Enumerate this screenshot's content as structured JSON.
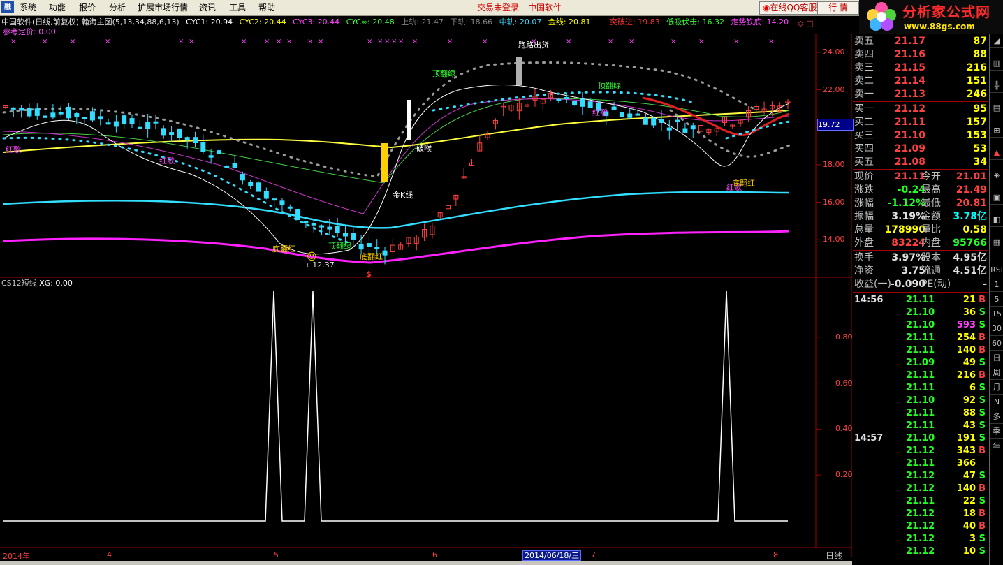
{
  "menu": {
    "items": [
      "系统",
      "功能",
      "报价",
      "分析",
      "扩展市场行情",
      "资讯",
      "工具",
      "帮助"
    ],
    "login_status": "交易未登录",
    "brand": "中国软件",
    "qq_button": "在线QQ客服",
    "market_button": "行 情",
    "logo_main": "分析家公式网",
    "logo_url": "www.88gs.com"
  },
  "chart_header": {
    "title": "中国软件(日线,前复权) 翰海主图(5,13,34,88,6,13)",
    "cyc1": "CYC1: 20.94",
    "cyc2": "CYC2: 20.44",
    "cyc3": "CYC3: 20.44",
    "cyc_inf": "CYC∞: 20.48",
    "upper": "上轨: 21.47",
    "lower": "下轨: 18.66",
    "mid": "中轨: 20.07",
    "gold": "金线: 20.81",
    "breakout": "突破进: 19.83",
    "lowbuy": "低吸伏击: 16.32",
    "trend": "走势铁底: 14.20",
    "ref_price": "参考定价: 0.00"
  },
  "sub_header": {
    "name": "CS12短线",
    "xg": "XG: 0.00"
  },
  "price_marker": "19.72",
  "annotations": {
    "red_song1": "红歌",
    "red_song2": "红歌",
    "red_song3": "红歌",
    "top_green1": "顶翻绿",
    "top_green2": "顶翻绿",
    "top_green3": "顶翻绿",
    "bottom_red1": "底翻红",
    "bottom_red2": "底翻红",
    "bottom_red3": "底翻红",
    "crack": "破喉",
    "gold_k": "金K线",
    "sell": "跑路出货",
    "low_price": "12.37",
    "red_swing": "红歌"
  },
  "chart_data": [
    {
      "type": "line",
      "panel": "main",
      "y_ticks": [
        "24.00",
        "22.00",
        "20.00",
        "18.00",
        "16.00",
        "14.00"
      ],
      "ylim": [
        12.0,
        25.0
      ],
      "x_labels": [
        "2014年",
        "4",
        "5",
        "6",
        "7",
        "8"
      ],
      "series": [
        {
          "name": "",
          "values": [
            21.1,
            20.9,
            20.8,
            20.7,
            20.5,
            20.3,
            20.1,
            19.8,
            19.2,
            18.5,
            17.5,
            16.5,
            15.6,
            14.9,
            14.4,
            13.8,
            13.5,
            13.8,
            14.5,
            16.5,
            19.0,
            20.8,
            21.3,
            21.5,
            21.3,
            21.0,
            20.8,
            20.5,
            20.2,
            20.0,
            20.1,
            20.5,
            21.0,
            21.2
          ]
        }
      ]
    },
    {
      "type": "line",
      "panel": "indicator",
      "y_ticks": [
        "0.80",
        "0.60",
        "0.40",
        "0.20"
      ],
      "ylim": [
        0,
        1.0
      ],
      "series": [
        {
          "name": "",
          "values": [
            0,
            0,
            0,
            0,
            0,
            0,
            0,
            0,
            0,
            0,
            0,
            0,
            0,
            1,
            0,
            1,
            0,
            0,
            0,
            0,
            0,
            0,
            0,
            0,
            0,
            0,
            0,
            0,
            0,
            0,
            0,
            0,
            0,
            0,
            0,
            0,
            0,
            0,
            0,
            1,
            0,
            0,
            0
          ]
        }
      ]
    }
  ],
  "quote": {
    "sells": [
      {
        "label": "卖五",
        "price": "21.17",
        "vol": "87"
      },
      {
        "label": "卖四",
        "price": "21.16",
        "vol": "88"
      },
      {
        "label": "卖三",
        "price": "21.15",
        "vol": "216"
      },
      {
        "label": "卖二",
        "price": "21.14",
        "vol": "151"
      },
      {
        "label": "卖一",
        "price": "21.13",
        "vol": "246"
      }
    ],
    "buys": [
      {
        "label": "买一",
        "price": "21.12",
        "vol": "95"
      },
      {
        "label": "买二",
        "price": "21.11",
        "vol": "157"
      },
      {
        "label": "买三",
        "price": "21.10",
        "vol": "153"
      },
      {
        "label": "买四",
        "price": "21.09",
        "vol": "53"
      },
      {
        "label": "买五",
        "price": "21.08",
        "vol": "34"
      }
    ],
    "stats": [
      {
        "l1": "现价",
        "v1": "21.11",
        "c1": "red",
        "l2": "今开",
        "v2": "21.01",
        "c2": "red"
      },
      {
        "l1": "涨跌",
        "v1": "-0.24",
        "c1": "green",
        "l2": "最高",
        "v2": "21.49",
        "c2": "red"
      },
      {
        "l1": "涨幅",
        "v1": "-1.12%",
        "c1": "green",
        "l2": "最低",
        "v2": "20.81",
        "c2": "red"
      },
      {
        "l1": "振幅",
        "v1": "3.19%",
        "c1": "white",
        "l2": "金额",
        "v2": "3.78亿",
        "c2": "cyan"
      },
      {
        "l1": "总量",
        "v1": "178990",
        "c1": "yellow",
        "l2": "量比",
        "v2": "0.58",
        "c2": "yellow"
      },
      {
        "l1": "外盘",
        "v1": "83224",
        "c1": "red",
        "l2": "内盘",
        "v2": "95766",
        "c2": "green"
      }
    ],
    "fund": [
      {
        "l1": "换手",
        "v1": "3.97%",
        "l2": "股本",
        "v2": "4.95亿"
      },
      {
        "l1": "净资",
        "v1": "3.75",
        "l2": "流通",
        "v2": "4.51亿"
      },
      {
        "l1": "收益(一)",
        "v1": "-0.090",
        "l2": "PE(动)",
        "v2": "-"
      }
    ],
    "ticks": [
      {
        "time": "14:56",
        "price": "21.11",
        "vol": "21",
        "bs": "B",
        "pc": "green",
        "vc": "yellow"
      },
      {
        "time": "",
        "price": "21.10",
        "vol": "36",
        "bs": "S",
        "pc": "green",
        "vc": "yellow"
      },
      {
        "time": "",
        "price": "21.10",
        "vol": "593",
        "bs": "S",
        "pc": "green",
        "vc": "magenta"
      },
      {
        "time": "",
        "price": "21.11",
        "vol": "254",
        "bs": "B",
        "pc": "green",
        "vc": "yellow"
      },
      {
        "time": "",
        "price": "21.11",
        "vol": "140",
        "bs": "B",
        "pc": "green",
        "vc": "yellow"
      },
      {
        "time": "",
        "price": "21.09",
        "vol": "49",
        "bs": "S",
        "pc": "green",
        "vc": "yellow"
      },
      {
        "time": "",
        "price": "21.11",
        "vol": "216",
        "bs": "B",
        "pc": "green",
        "vc": "yellow"
      },
      {
        "time": "",
        "price": "21.11",
        "vol": "6",
        "bs": "S",
        "pc": "green",
        "vc": "yellow"
      },
      {
        "time": "",
        "price": "21.10",
        "vol": "92",
        "bs": "S",
        "pc": "green",
        "vc": "yellow"
      },
      {
        "time": "",
        "price": "21.11",
        "vol": "88",
        "bs": "S",
        "pc": "green",
        "vc": "yellow"
      },
      {
        "time": "",
        "price": "21.11",
        "vol": "43",
        "bs": "S",
        "pc": "green",
        "vc": "yellow"
      },
      {
        "time": "14:57",
        "price": "21.10",
        "vol": "191",
        "bs": "S",
        "pc": "green",
        "vc": "yellow"
      },
      {
        "time": "",
        "price": "21.12",
        "vol": "343",
        "bs": "B",
        "pc": "green",
        "vc": "yellow"
      },
      {
        "time": "",
        "price": "21.11",
        "vol": "366",
        "bs": "",
        "pc": "green",
        "vc": "yellow"
      },
      {
        "time": "",
        "price": "21.12",
        "vol": "47",
        "bs": "S",
        "pc": "green",
        "vc": "yellow"
      },
      {
        "time": "",
        "price": "21.12",
        "vol": "140",
        "bs": "B",
        "pc": "green",
        "vc": "yellow"
      },
      {
        "time": "",
        "price": "21.11",
        "vol": "22",
        "bs": "S",
        "pc": "green",
        "vc": "yellow"
      },
      {
        "time": "",
        "price": "21.12",
        "vol": "18",
        "bs": "B",
        "pc": "green",
        "vc": "yellow"
      },
      {
        "time": "",
        "price": "21.12",
        "vol": "40",
        "bs": "B",
        "pc": "green",
        "vc": "yellow"
      },
      {
        "time": "",
        "price": "21.12",
        "vol": "3",
        "bs": "S",
        "pc": "green",
        "vc": "yellow"
      },
      {
        "time": "",
        "price": "21.12",
        "vol": "10",
        "bs": "S",
        "pc": "green",
        "vc": "yellow"
      }
    ]
  },
  "side_toolbar": [
    "RSI",
    "1",
    "5",
    "15",
    "30",
    "60",
    "日",
    "周",
    "月",
    "N",
    "多",
    "季",
    "年"
  ],
  "bottom": {
    "date_cursor": "2014/06/18/三",
    "period": "日线"
  },
  "colors": {
    "up": "#ff4040",
    "down": "#00ffff",
    "gold": "#ffff00",
    "magenta": "#ff22ff",
    "cyan_band": "#33ddff",
    "grid": "#8b0000"
  }
}
